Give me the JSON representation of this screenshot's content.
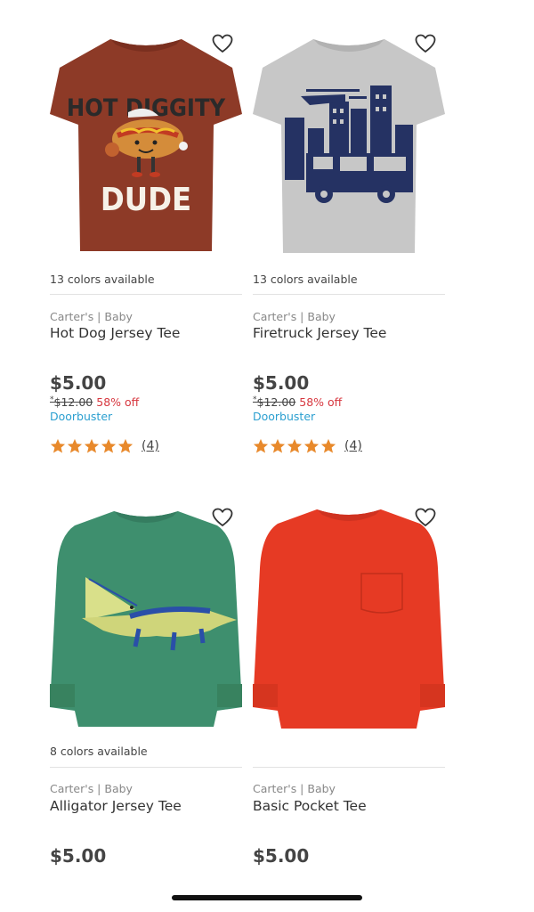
{
  "colors": {
    "sale": "#d7373f",
    "doorbuster": "#2b9fd0",
    "star": "#e8892b"
  },
  "products": [
    {
      "image": "hot-dog-tee-image",
      "colors_available": "13 colors available",
      "brand": "Carter's | Baby",
      "name": "Hot Dog Jersey Tee",
      "price": "$5.00",
      "was_price": "$12.00",
      "discount": "58% off",
      "tag": "Doorbuster",
      "rating": 5,
      "reviews": "(4)",
      "shirt_graphic_text": [
        "HOT DIGGITY",
        "DUDE"
      ]
    },
    {
      "image": "firetruck-tee-image",
      "colors_available": "13 colors available",
      "brand": "Carter's | Baby",
      "name": "Firetruck Jersey Tee",
      "price": "$5.00",
      "was_price": "$12.00",
      "discount": "58% off",
      "tag": "Doorbuster",
      "rating": 5,
      "reviews": "(4)"
    },
    {
      "image": "alligator-tee-image",
      "colors_available": "8 colors available",
      "brand": "Carter's | Baby",
      "name": "Alligator Jersey Tee",
      "price": "$5.00"
    },
    {
      "image": "pocket-tee-image",
      "colors_available": "",
      "brand": "Carter's | Baby",
      "name": "Basic Pocket Tee",
      "price": "$5.00"
    }
  ]
}
